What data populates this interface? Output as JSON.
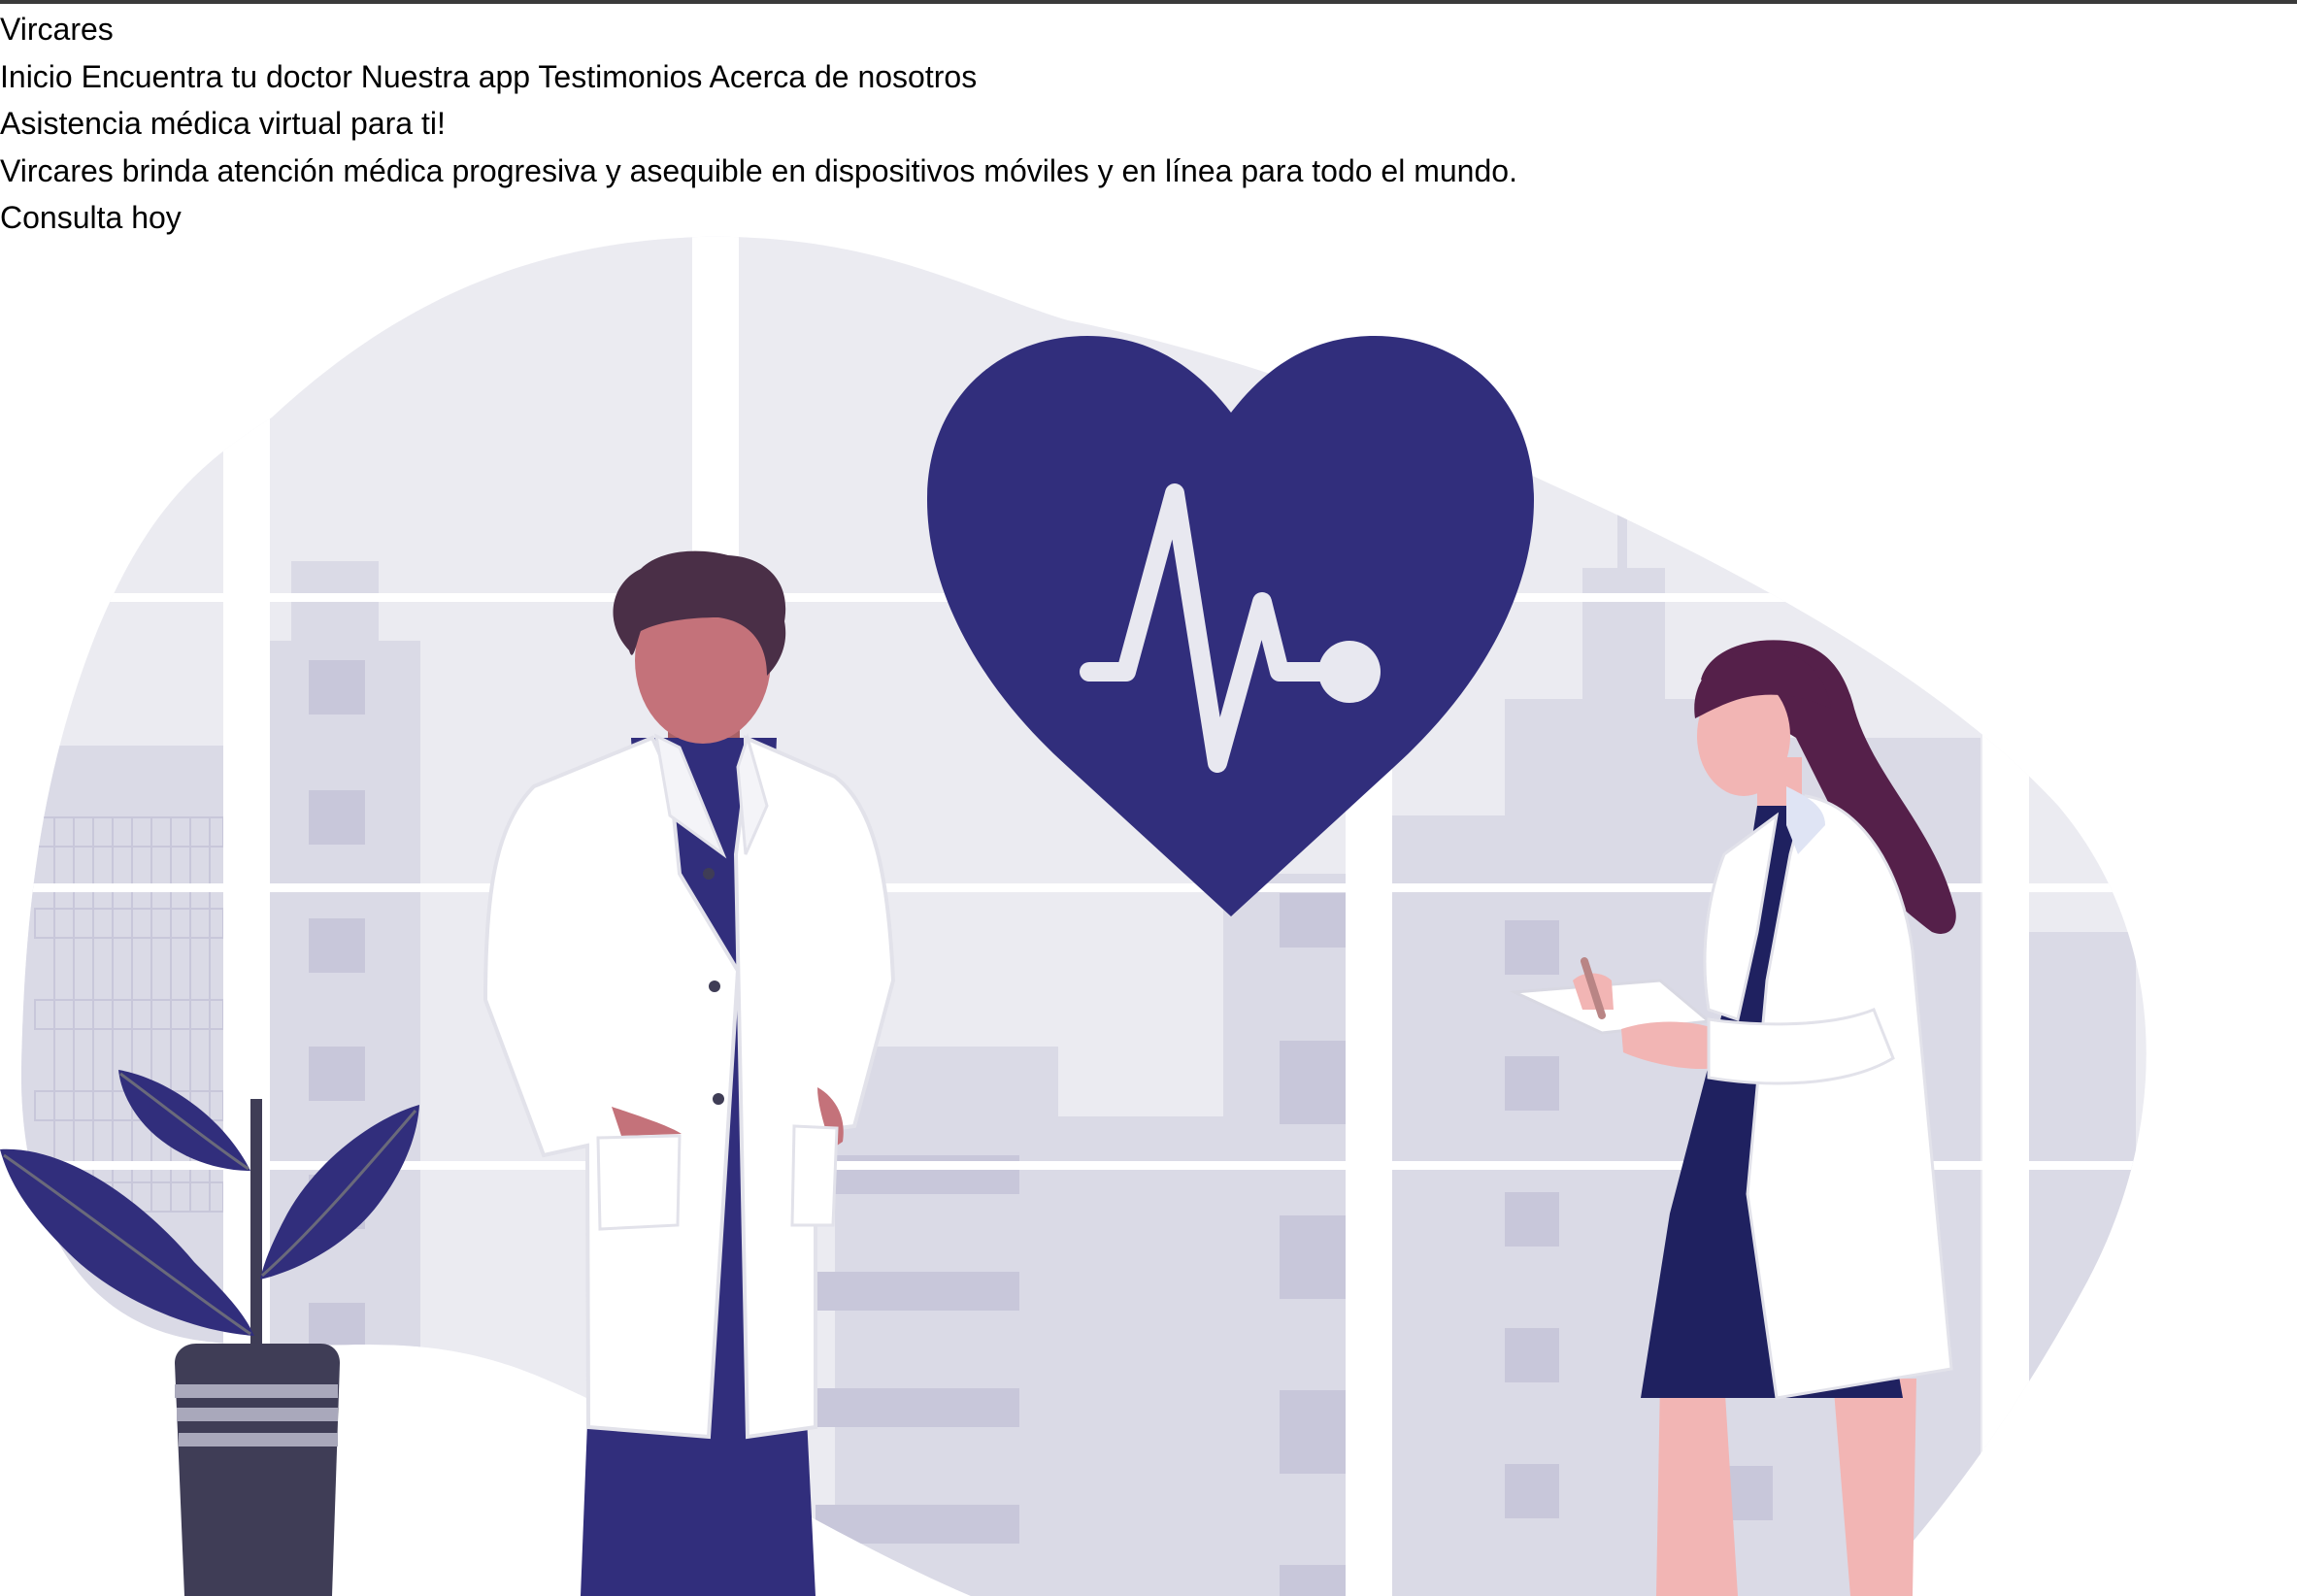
{
  "brand": {
    "name": "Vircares"
  },
  "nav": {
    "items": [
      {
        "label": "Inicio"
      },
      {
        "label": "Encuentra tu doctor"
      },
      {
        "label": "Nuestra app"
      },
      {
        "label": "Testimonios"
      },
      {
        "label": "Acerca de nosotros"
      }
    ]
  },
  "hero": {
    "title": "Asistencia médica virtual para ti!",
    "description": "Vircares brinda atención médica progresiva y asequible en dispositivos móviles y en línea para todo el mundo.",
    "cta_label": "Consulta hoy"
  },
  "illustration": {
    "icon": "doctors-heart-illustration",
    "colors": {
      "heart": "#312e7c",
      "city_light": "#ebebf1",
      "city_mid": "#dadae6",
      "city_dark": "#c8c7da",
      "plant_leaf": "#312e7c",
      "pot": "#3f3d56",
      "skin_male": "#c4727a",
      "hair_male": "#4a2f47",
      "skin_female": "#f2b5b4",
      "hair_female": "#55204a",
      "coat": "#ffffff",
      "scrubs": "#312e7c",
      "dress": "#1f2160"
    }
  }
}
